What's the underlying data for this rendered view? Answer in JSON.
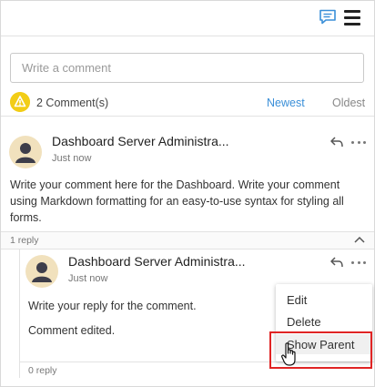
{
  "toolbar": {
    "comment_icon": "comment-icon",
    "menu_icon": "hamburger-menu-icon"
  },
  "comment_box": {
    "placeholder": "Write a comment",
    "value": ""
  },
  "summary": {
    "count_label": "2 Comment(s)",
    "sort_newest": "Newest",
    "sort_oldest": "Oldest",
    "accent": "#3a8fd8",
    "warning_color": "#f2cd16"
  },
  "comment": {
    "author": "Dashboard Server Administra...",
    "time": "Just now",
    "body": "Write your comment here for the Dashboard. Write your comment using Markdown formatting for an easy-to-use syntax for styling all forms.",
    "reply_count": "1 reply"
  },
  "reply": {
    "author": "Dashboard Server Administra...",
    "time": "Just now",
    "body": "Write your reply for the comment.",
    "edited": "Comment edited.",
    "reply_count": "0 reply"
  },
  "context_menu": {
    "items": [
      {
        "label": "Edit"
      },
      {
        "label": "Delete"
      },
      {
        "label": "Show Parent"
      }
    ],
    "highlight_color": "#e02424"
  }
}
